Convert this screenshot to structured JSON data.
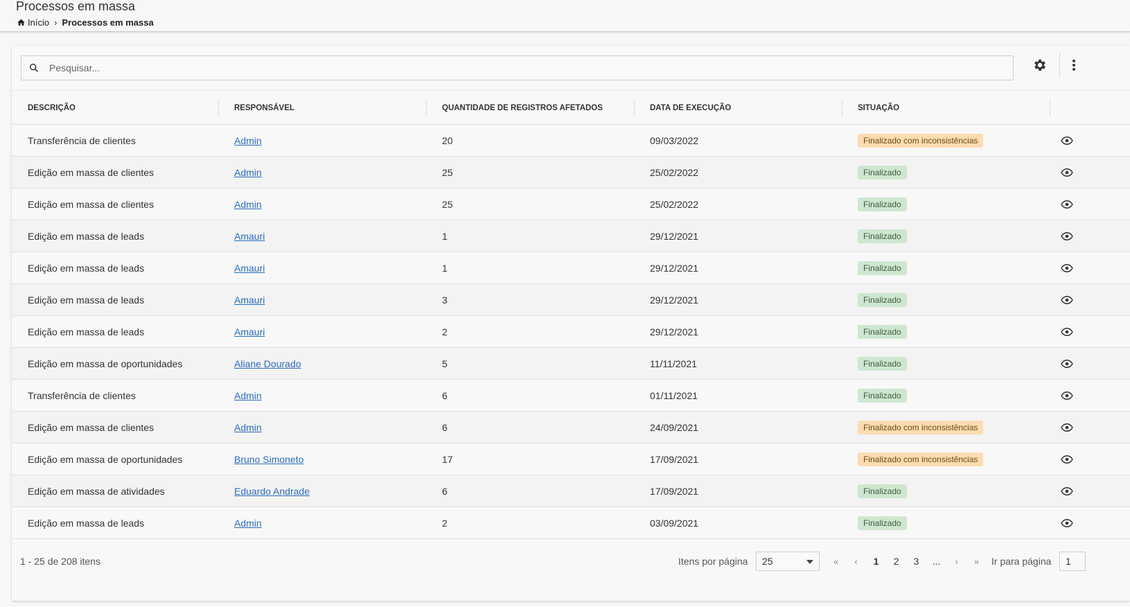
{
  "header": {
    "title": "Processos em massa",
    "breadcrumb": {
      "home": "Início",
      "current": "Processos em massa"
    }
  },
  "search": {
    "placeholder": "Pesquisar..."
  },
  "icons": {
    "home": "home-icon",
    "chevron": "chevron-right-icon",
    "search": "search-icon",
    "settings": "gear-icon",
    "more": "more-vertical-icon",
    "view": "eye-icon"
  },
  "table": {
    "columns": [
      "DESCRIÇÃO",
      "RESPONSÁVEL",
      "QUANTIDADE DE REGISTROS AFETADOS",
      "DATA DE EXECUÇÃO",
      "SITUAÇÃO"
    ],
    "rows": [
      {
        "descricao": "Transferência de clientes",
        "responsavel": "Admin",
        "quantidade": "20",
        "data": "09/03/2022",
        "situacao": "Finalizado com inconsistências",
        "status": "warn"
      },
      {
        "descricao": "Edição em massa de clientes",
        "responsavel": "Admin",
        "quantidade": "25",
        "data": "25/02/2022",
        "situacao": "Finalizado",
        "status": "ok"
      },
      {
        "descricao": "Edição em massa de clientes",
        "responsavel": "Admin",
        "quantidade": "25",
        "data": "25/02/2022",
        "situacao": "Finalizado",
        "status": "ok"
      },
      {
        "descricao": "Edição em massa de leads",
        "responsavel": "Amauri",
        "quantidade": "1",
        "data": "29/12/2021",
        "situacao": "Finalizado",
        "status": "ok"
      },
      {
        "descricao": "Edição em massa de leads",
        "responsavel": "Amauri",
        "quantidade": "1",
        "data": "29/12/2021",
        "situacao": "Finalizado",
        "status": "ok"
      },
      {
        "descricao": "Edição em massa de leads",
        "responsavel": "Amauri",
        "quantidade": "3",
        "data": "29/12/2021",
        "situacao": "Finalizado",
        "status": "ok"
      },
      {
        "descricao": "Edição em massa de leads",
        "responsavel": "Amauri",
        "quantidade": "2",
        "data": "29/12/2021",
        "situacao": "Finalizado",
        "status": "ok"
      },
      {
        "descricao": "Edição em massa de oportunidades",
        "responsavel": "Aliane Dourado",
        "quantidade": "5",
        "data": "11/11/2021",
        "situacao": "Finalizado",
        "status": "ok"
      },
      {
        "descricao": "Transferência de clientes",
        "responsavel": "Admin",
        "quantidade": "6",
        "data": "01/11/2021",
        "situacao": "Finalizado",
        "status": "ok"
      },
      {
        "descricao": "Edição em massa de clientes",
        "responsavel": "Admin",
        "quantidade": "6",
        "data": "24/09/2021",
        "situacao": "Finalizado com inconsistências",
        "status": "warn"
      },
      {
        "descricao": "Edição em massa de oportunidades",
        "responsavel": "Bruno Simoneto",
        "quantidade": "17",
        "data": "17/09/2021",
        "situacao": "Finalizado com inconsistências",
        "status": "warn"
      },
      {
        "descricao": "Edição em massa de atividades",
        "responsavel": "Eduardo Andrade",
        "quantidade": "6",
        "data": "17/09/2021",
        "situacao": "Finalizado",
        "status": "ok"
      },
      {
        "descricao": "Edição em massa de leads",
        "responsavel": "Admin",
        "quantidade": "2",
        "data": "03/09/2021",
        "situacao": "Finalizado",
        "status": "ok"
      }
    ]
  },
  "footer": {
    "range": "1 - 25 de 208 itens",
    "per_page_label": "Itens por página",
    "per_page_value": "25",
    "pages": [
      "1",
      "2",
      "3",
      "..."
    ],
    "first": "«",
    "prev": "‹",
    "next": "›",
    "last": "»",
    "goto_label": "Ir para página",
    "goto_value": "1"
  },
  "colors": {
    "link": "#2c6bb8",
    "badge_ok_bg": "#cfe6cf",
    "badge_warn_bg": "#fbdcb2"
  }
}
